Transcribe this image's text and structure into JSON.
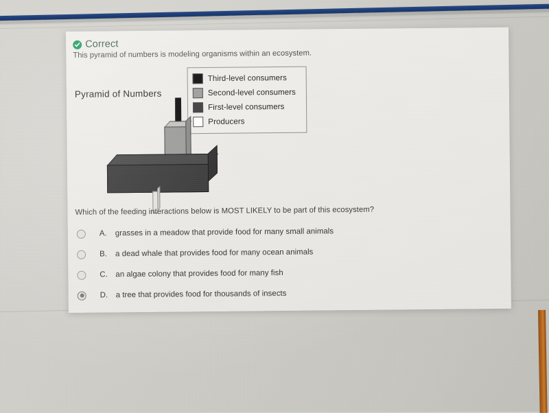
{
  "status": {
    "icon": "check-circle-icon",
    "label": "Correct",
    "color": "#1d9a5c"
  },
  "prompt": "This pyramid of numbers is modeling organisms within an ecosystem.",
  "diagram": {
    "title": "Pyramid of Numbers",
    "legend": [
      {
        "label": "Third-level consumers",
        "color": "#0b0b0b"
      },
      {
        "label": "Second-level consumers",
        "color": "#9b9b99"
      },
      {
        "label": "First-level consumers",
        "color": "#3c3c3c"
      },
      {
        "label": "Producers",
        "color": "#ffffff"
      }
    ]
  },
  "question": "Which of the feeding interactions below is MOST LIKELY to be part of this ecosystem?",
  "options": [
    {
      "letter": "A.",
      "label": "grasses in a meadow that provide food for many small animals",
      "selected": false
    },
    {
      "letter": "B.",
      "label": "a dead whale that provides food for many ocean animals",
      "selected": false
    },
    {
      "letter": "C.",
      "label": "an algae colony that provides food for many fish",
      "selected": false
    },
    {
      "letter": "D.",
      "label": "a tree that provides food for thousands of insects",
      "selected": true
    }
  ]
}
